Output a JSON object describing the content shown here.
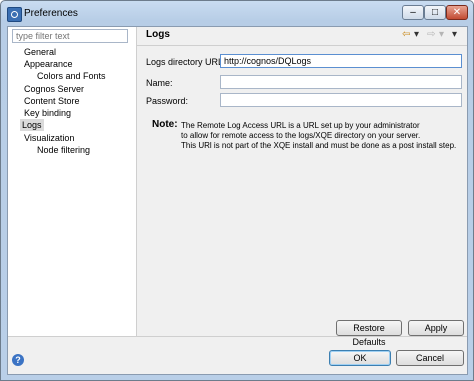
{
  "window": {
    "title": "Preferences",
    "minimize_glyph": "–",
    "maximize_glyph": "□",
    "close_glyph": "✕"
  },
  "filter": {
    "placeholder": "type filter text"
  },
  "tree": {
    "items": [
      {
        "label": "General",
        "indent": 0
      },
      {
        "label": "Appearance",
        "indent": 0
      },
      {
        "label": "Colors and Fonts",
        "indent": 1
      },
      {
        "label": "Cognos Server",
        "indent": 0
      },
      {
        "label": "Content Store",
        "indent": 0
      },
      {
        "label": "Key binding",
        "indent": 0
      },
      {
        "label": "Logs",
        "indent": 0,
        "selected": true
      },
      {
        "label": "Visualization",
        "indent": 0
      },
      {
        "label": "Node filtering",
        "indent": 1
      }
    ]
  },
  "page": {
    "title": "Logs",
    "nav": {
      "back": "⇦",
      "back_menu": "▾",
      "forward": "⇨",
      "forward_menu": "▾",
      "view_menu": "▾"
    },
    "fields": {
      "logs_dir": {
        "label": "Logs directory URL:",
        "value": "http://cognos/DQLogs"
      },
      "name": {
        "label": "Name:",
        "value": ""
      },
      "password": {
        "label": "Password:",
        "value": ""
      }
    },
    "note": {
      "label": "Note:",
      "lines": [
        "The Remote Log Access URL is a URL set up by your administrator",
        "to allow for remote access to the logs/XQE directory on your server.",
        "This URl is not part of the XQE install and must be done as a post install step."
      ]
    },
    "restore_defaults_label": "Restore Defaults",
    "apply_label": "Apply"
  },
  "footer": {
    "help_glyph": "?",
    "ok_label": "OK",
    "cancel_label": "Cancel"
  },
  "colors": {
    "accent": "#3399ff",
    "selection": "#dadada"
  }
}
